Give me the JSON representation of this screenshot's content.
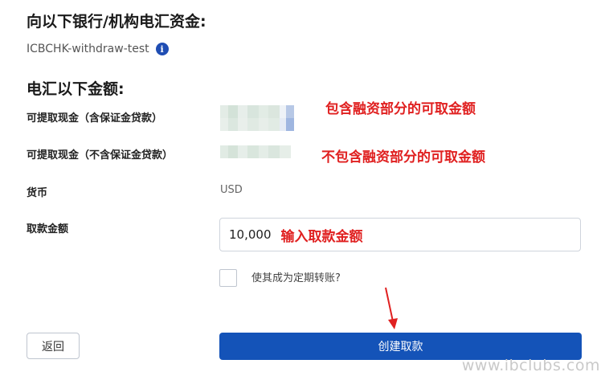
{
  "heading_bank": "向以下银行/机构电汇资金:",
  "bank_name": "ICBCHK-withdraw-test",
  "info_icon": "info-icon",
  "heading_amount": "电汇以下金额:",
  "rows": {
    "withdrawable_incl": {
      "label": "可提取现金（含保证金贷款）",
      "annotation": "包含融资部分的可取金额"
    },
    "withdrawable_excl": {
      "label": "可提取现金（不含保证金贷款）",
      "annotation": "不包含融资部分的可取金额"
    },
    "currency": {
      "label": "货币",
      "value": "USD"
    },
    "amount": {
      "label": "取款金额",
      "value": "10,000",
      "annotation": "输入取款金额"
    }
  },
  "standing_transfer_label": "使其成为定期转账?",
  "back_button": "返回",
  "create_button": "创建取款",
  "watermark": "www.ibclubs.com",
  "colors": {
    "primary": "#1453b8",
    "annotation": "#e02020",
    "info": "#1f4db3"
  }
}
